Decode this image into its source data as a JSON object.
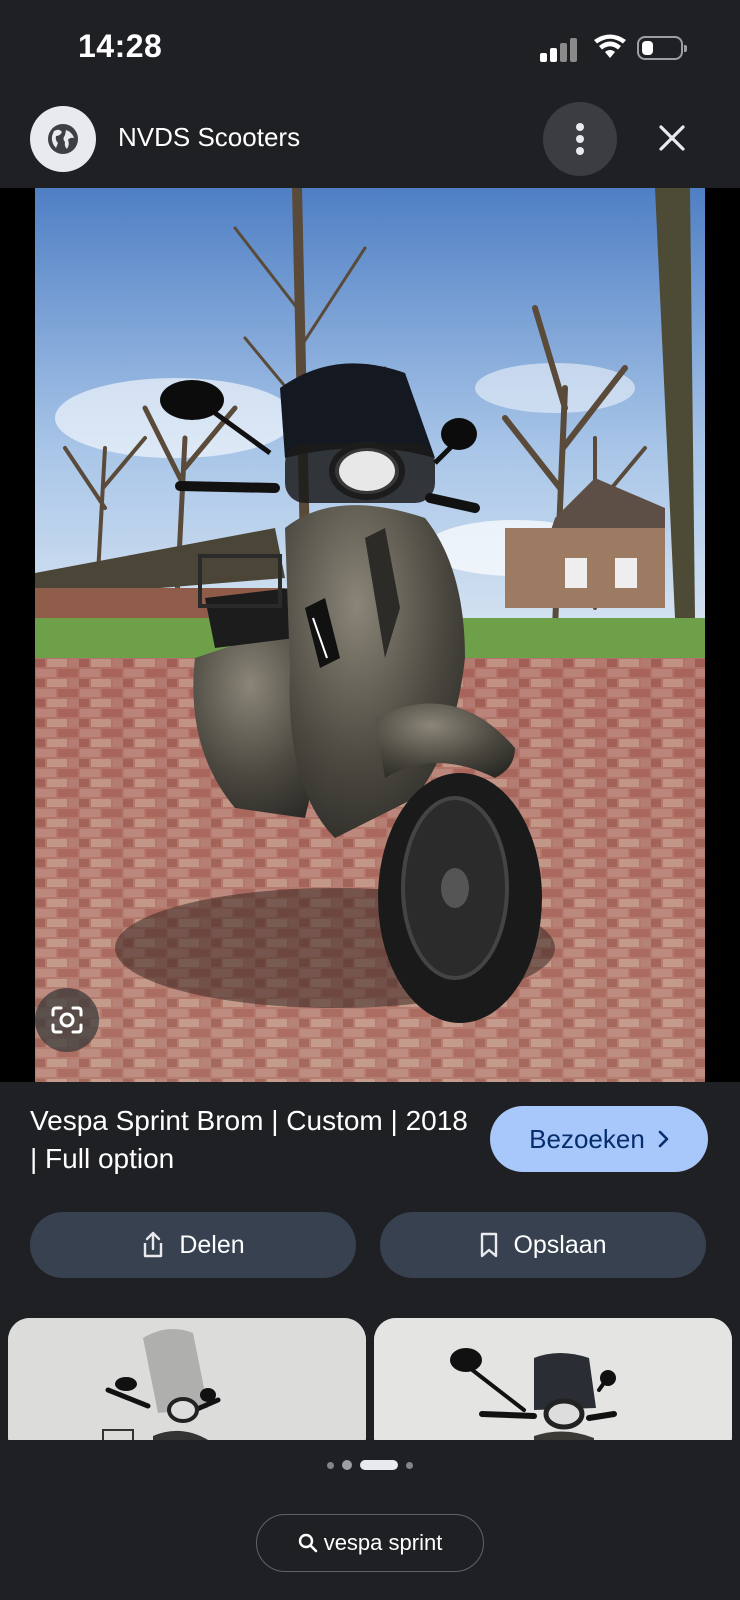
{
  "status_bar": {
    "time": "14:28",
    "signal_icon": "cellular-signal-icon",
    "wifi_icon": "wifi-icon",
    "battery_icon": "battery-icon",
    "battery_level": 0.3
  },
  "header": {
    "site_icon": "globe-icon",
    "site_name": "NVDS Scooters",
    "more_icon": "more-vert-icon",
    "close_icon": "close-icon"
  },
  "image": {
    "lens_icon": "google-lens-icon"
  },
  "result": {
    "title": "Vespa Sprint Brom | Custom | 2018 | Full option",
    "visit_label": "Bezoeken",
    "visit_icon": "chevron-right-icon"
  },
  "actions": {
    "share_label": "Delen",
    "share_icon": "share-icon",
    "save_label": "Opslaan",
    "save_icon": "bookmark-icon"
  },
  "pagination": {
    "total": 4,
    "active_index": 2
  },
  "search_chip": {
    "icon": "search-icon",
    "query": "vespa sprint"
  },
  "colors": {
    "background": "#1f2024",
    "visit_button": "#a8c7fa",
    "action_button": "#37414f"
  }
}
